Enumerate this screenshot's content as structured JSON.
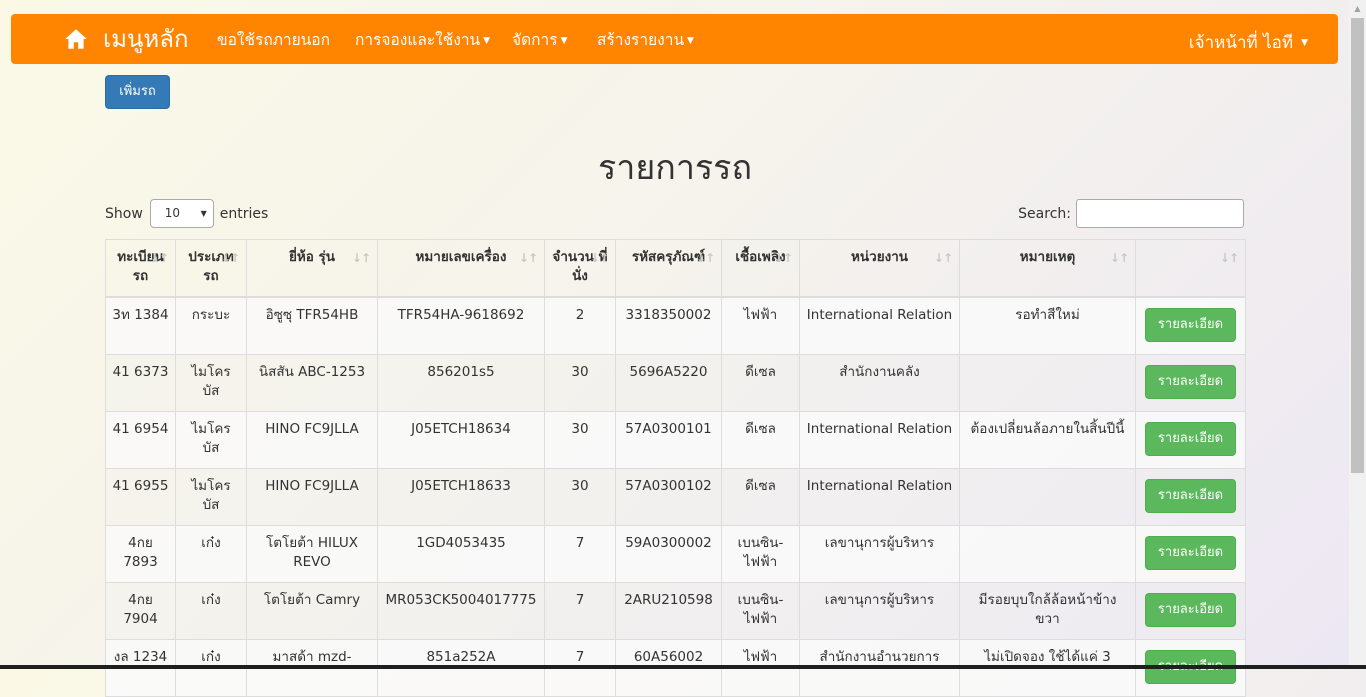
{
  "nav": {
    "brand": "เมนูหลัก",
    "items": [
      "ขอใช้รถภายนอก",
      "การจองและใช้งาน",
      "จัดการ",
      "สร้างรายงาน"
    ],
    "user": "เจ้าหน้าที่ ไอที"
  },
  "add_button": "เพิ่มรถ",
  "title": "รายการรถ",
  "length": {
    "show": "Show",
    "value": "10",
    "entries": "entries"
  },
  "search": {
    "label": "Search:"
  },
  "table": {
    "headers": [
      "ทะเบียน รถ",
      "ประเภท รถ",
      "ยี่ห้อ รุ่น",
      "หมายเลขเครื่อง",
      "จำนวน ที่นั่ง",
      "รหัสครุภัณฑ์",
      "เชื้อเพลิง",
      "หน่วยงาน",
      "หมายเหตุ",
      ""
    ],
    "detail_label": "รายละเอียด",
    "rows": [
      [
        "3ท 1384",
        "กระบะ",
        "อิซูซุ TFR54HB",
        "TFR54HA-9618692",
        "2",
        "3318350002",
        "ไฟฟ้า",
        "International Relation",
        "รอทำสีใหม่"
      ],
      [
        "41 6373",
        "ไมโคร บัส",
        "นิสสัน ABC-1253",
        "856201s5",
        "30",
        "5696A5220",
        "ดีเซล",
        "สำนักงานคลัง",
        ""
      ],
      [
        "41 6954",
        "ไมโคร บัส",
        "HINO FC9JLLA",
        "J05ETCH18634",
        "30",
        "57A0300101",
        "ดีเซล",
        "International Relation",
        "ต้องเปลี่ยนล้อภายในสิ้นปีนี้"
      ],
      [
        "41 6955",
        "ไมโคร บัส",
        "HINO FC9JLLA",
        "J05ETCH18633",
        "30",
        "57A0300102",
        "ดีเซล",
        "International Relation",
        ""
      ],
      [
        "4กย 7893",
        "เก๋ง",
        "โตโยต้า HILUX REVO",
        "1GD4053435",
        "7",
        "59A0300002",
        "เบนซิน- ไฟฟ้า",
        "เลขานุการผู้บริหาร",
        ""
      ],
      [
        "4กย 7904",
        "เก๋ง",
        "โตโยต้า Camry",
        "MR053CK5004017775",
        "7",
        "2ARU210598",
        "เบนซิน- ไฟฟ้า",
        "เลขานุการผู้บริหาร",
        "มีรอยบุบใกล้ล้อหน้าข้าง ขวา"
      ],
      [
        "งล 1234",
        "เก๋ง",
        "มาสด้า mzd-",
        "851a252A",
        "7",
        "60A56002",
        "ไฟฟ้า",
        "สำนักงานอำนวยการ",
        "ไม่เปิดจอง ใช้ได้แค่ 3"
      ]
    ]
  }
}
